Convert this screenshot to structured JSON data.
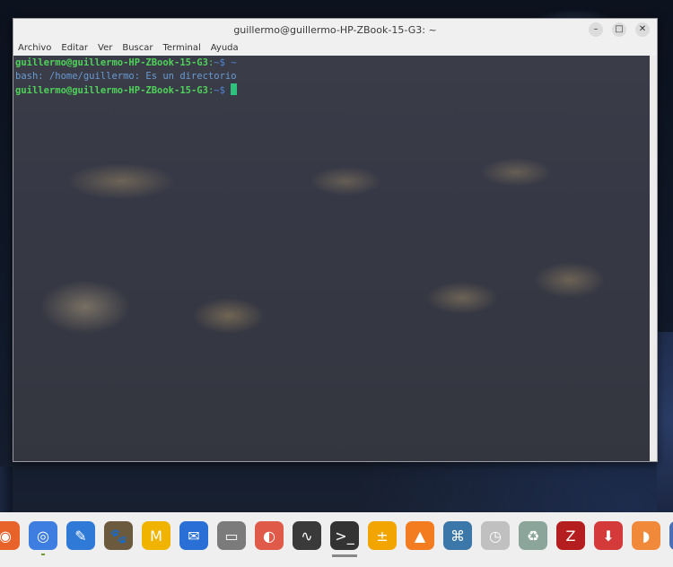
{
  "window": {
    "title": "guillermo@guillermo-HP-ZBook-15-G3: ~",
    "buttons": {
      "minimize": "–",
      "maximize": "□",
      "close": "✕"
    }
  },
  "menu": [
    "Archivo",
    "Editar",
    "Ver",
    "Buscar",
    "Terminal",
    "Ayuda"
  ],
  "terminal": {
    "lines": [
      {
        "user": "guillermo@guillermo-HP-ZBook-15-G3",
        "path": "~",
        "cmd": " ~"
      },
      {
        "output": "bash: /home/guillermo: Es un directorio"
      },
      {
        "user": "guillermo@guillermo-HP-ZBook-15-G3",
        "path": "~",
        "cmd": " "
      }
    ]
  },
  "dock": {
    "icons": [
      {
        "name": "firefox-icon",
        "glyph": "◉",
        "color": "#e8632a"
      },
      {
        "name": "chromium-icon",
        "glyph": "◎",
        "color": "#3d7ee0"
      },
      {
        "name": "text-editor-icon",
        "glyph": "✎",
        "color": "#2f7ad6"
      },
      {
        "name": "gimp-icon",
        "glyph": "🐾",
        "color": "#6b5a3e"
      },
      {
        "name": "m-app-icon",
        "glyph": "M",
        "color": "#f0b400"
      },
      {
        "name": "thunderbird-icon",
        "glyph": "✉",
        "color": "#2a6fd6"
      },
      {
        "name": "files-icon",
        "glyph": "▭",
        "color": "#7b7b7b"
      },
      {
        "name": "settings-toggle-icon",
        "glyph": "◐",
        "color": "#e05a4a"
      },
      {
        "name": "system-monitor-icon",
        "glyph": "∿",
        "color": "#3a3a3a"
      },
      {
        "name": "terminal-icon",
        "glyph": ">_",
        "color": "#333333"
      },
      {
        "name": "calculator-icon",
        "glyph": "±",
        "color": "#f2a500"
      },
      {
        "name": "vlc-icon",
        "glyph": "▲",
        "color": "#f47c20"
      },
      {
        "name": "python-icon",
        "glyph": "⌘",
        "color": "#3b77a8"
      },
      {
        "name": "clock-icon",
        "glyph": "◷",
        "color": "#c0c0c0"
      },
      {
        "name": "trash-icon",
        "glyph": "♻",
        "color": "#8ba59a"
      },
      {
        "name": "filezilla-icon",
        "glyph": "Z",
        "color": "#b51e1e"
      },
      {
        "name": "downloader-icon",
        "glyph": "⬇",
        "color": "#d43a3a"
      },
      {
        "name": "orange-app-icon",
        "glyph": "◗",
        "color": "#f08a3a"
      },
      {
        "name": "partial-app-icon",
        "glyph": "",
        "color": "#4a6fb5"
      }
    ]
  }
}
